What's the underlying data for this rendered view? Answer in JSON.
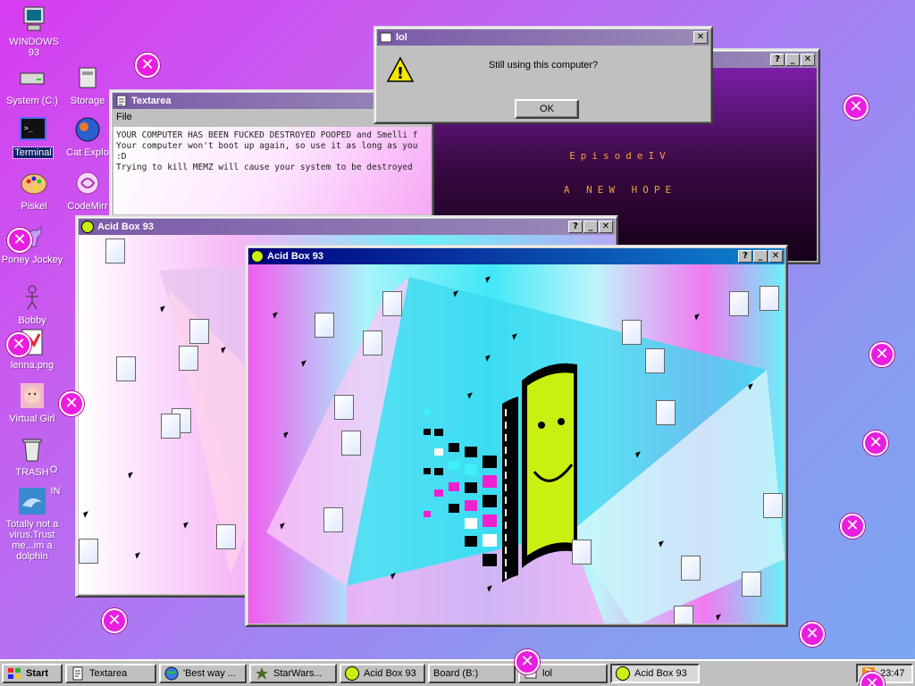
{
  "desktop": {
    "icons": [
      {
        "label": "WINDOWS 93",
        "name": "windows93-icon"
      },
      {
        "label": "System (C:)",
        "name": "system-drive-icon"
      },
      {
        "label": "Storage",
        "name": "storage-icon"
      },
      {
        "label": "Terminal",
        "name": "terminal-icon"
      },
      {
        "label": "Cat Explo",
        "name": "cat-explorer-icon"
      },
      {
        "label": "Piskel",
        "name": "piskel-icon"
      },
      {
        "label": "CodeMirr",
        "name": "codemirror-icon"
      },
      {
        "label": "Poney Jockey",
        "name": "poney-jockey-icon"
      },
      {
        "label": "Bobby",
        "name": "bobby-icon"
      },
      {
        "label": "lenna.png",
        "name": "lenna-icon"
      },
      {
        "label": "Virtual Girl",
        "name": "virtual-girl-icon"
      },
      {
        "label": "TRASH",
        "name": "trash-icon"
      },
      {
        "label": "Totally not a virus.Trust me...im a dolphin",
        "name": "dolphin-icon"
      },
      {
        "label": "O",
        "name": "partial-icon-o"
      },
      {
        "label": "IN",
        "name": "partial-icon-in"
      }
    ],
    "close_glyph": "✕"
  },
  "textarea_window": {
    "title": "Textarea",
    "menu_file": "File",
    "lines": [
      "YOUR COMPUTER HAS BEEN FUCKED DESTROYED POOPED and Smelli f",
      "Your computer won't boot up again, so use it as long as you",
      ":D",
      "Trying to kill MEMZ will cause your system to be destroyed"
    ]
  },
  "starwars_window": {
    "episode": "EpisodeIV",
    "subtitle": "A NEW HOPE",
    "btn_help": "?",
    "btn_min": "_",
    "btn_close": "✕"
  },
  "dialog": {
    "title": "lol",
    "message": "Still using this computer?",
    "ok_label": "OK",
    "warning_glyph": "!"
  },
  "acid_box_back": {
    "title": "Acid Box 93"
  },
  "acid_box_front": {
    "title": "Acid Box 93"
  },
  "taskbar": {
    "start_label": "Start",
    "items": [
      {
        "label": "Textarea"
      },
      {
        "label": "'Best way ..."
      },
      {
        "label": "StarWars..."
      },
      {
        "label": "Acid Box 93"
      },
      {
        "label": "Board (B:)"
      },
      {
        "label": "lol"
      },
      {
        "label": "Acid Box 93"
      }
    ],
    "clock": "23:47"
  },
  "colors": {
    "accent_pink": "#e91ee0",
    "title_active": "#000080",
    "smiley_yellow": "#c8f010"
  }
}
